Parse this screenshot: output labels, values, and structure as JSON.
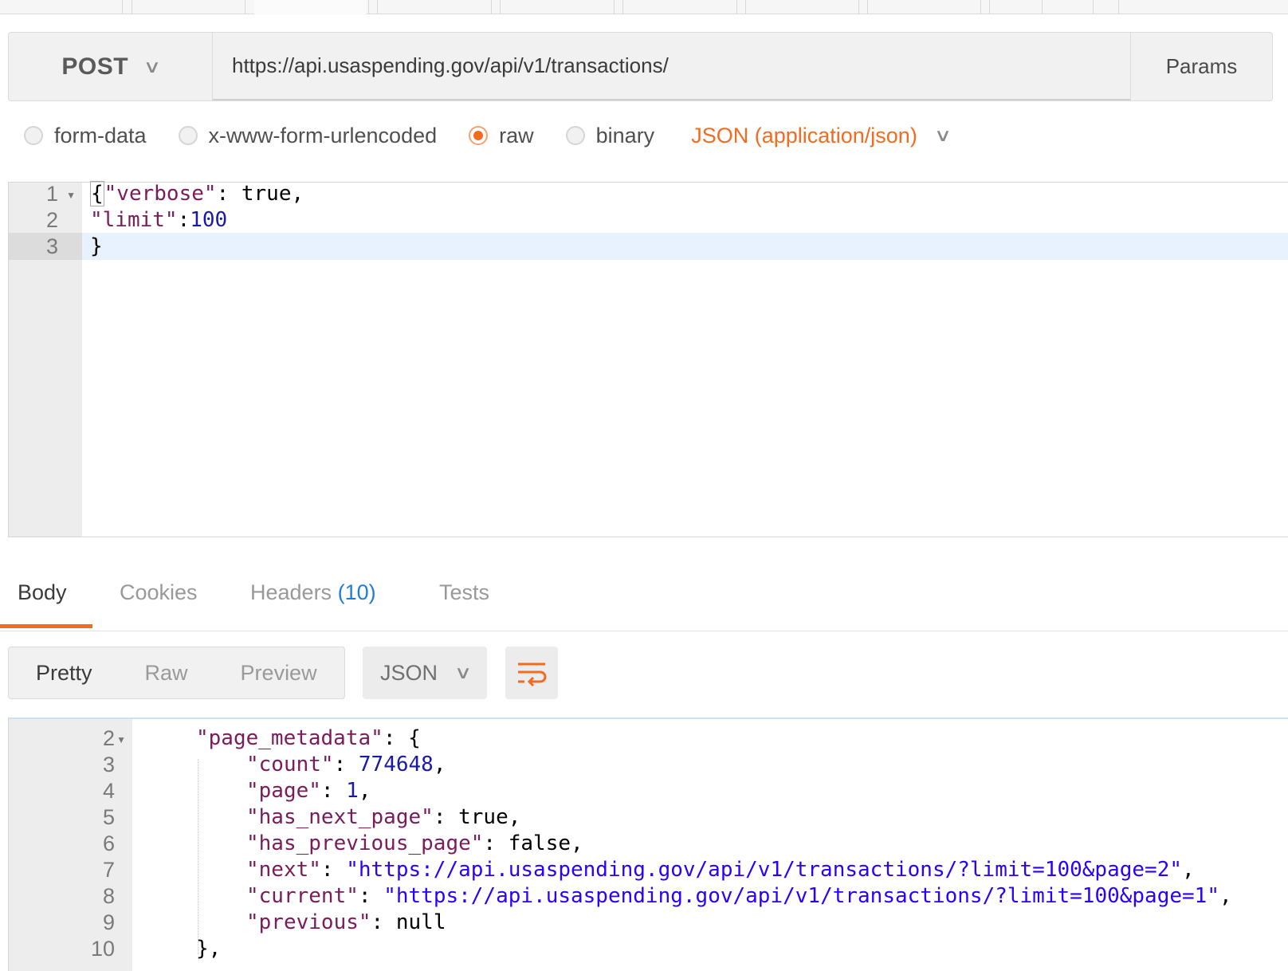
{
  "request": {
    "method": "POST",
    "url": "https://api.usaspending.gov/api/v1/transactions/",
    "params_label": "Params"
  },
  "body_types": [
    {
      "label": "form-data",
      "selected": false
    },
    {
      "label": "x-www-form-urlencoded",
      "selected": false
    },
    {
      "label": "raw",
      "selected": true
    },
    {
      "label": "binary",
      "selected": false
    }
  ],
  "content_type": "JSON (application/json)",
  "request_body": {
    "lines": [
      {
        "num": "1",
        "key": "\"verbose\"",
        "sep": ": ",
        "val": "true,"
      },
      {
        "num": "2",
        "key": "\"limit\"",
        "sep": ":",
        "val": "100"
      },
      {
        "num": "3",
        "text": "}"
      }
    ]
  },
  "response_tabs": {
    "body": "Body",
    "cookies": "Cookies",
    "headers": "Headers",
    "headers_count": "(10)",
    "tests": "Tests"
  },
  "view_modes": [
    "Pretty",
    "Raw",
    "Preview"
  ],
  "format": "JSON",
  "response_body": {
    "lines": [
      {
        "num": "2",
        "key": "\"page_metadata\"",
        "sep": ": ",
        "val": "{"
      },
      {
        "num": "3",
        "key": "\"count\"",
        "sep": ": ",
        "val": "774648",
        "tail": ","
      },
      {
        "num": "4",
        "key": "\"page\"",
        "sep": ": ",
        "val": "1",
        "tail": ","
      },
      {
        "num": "5",
        "key": "\"has_next_page\"",
        "sep": ": ",
        "val": "true,"
      },
      {
        "num": "6",
        "key": "\"has_previous_page\"",
        "sep": ": ",
        "val": "false,"
      },
      {
        "num": "7",
        "key": "\"next\"",
        "sep": ": ",
        "val": "\"https://api.usaspending.gov/api/v1/transactions/?limit=100&page=2\"",
        "tail": ","
      },
      {
        "num": "8",
        "key": "\"current\"",
        "sep": ": ",
        "val": "\"https://api.usaspending.gov/api/v1/transactions/?limit=100&page=1\"",
        "tail": ","
      },
      {
        "num": "9",
        "key": "\"previous\"",
        "sep": ": ",
        "val": "null"
      },
      {
        "num": "10",
        "text": "},"
      }
    ]
  },
  "colors": {
    "accent": "#f26b21",
    "json_key": "#7b1c5a",
    "json_number": "#1a1aa6",
    "json_string": "#2a00ff",
    "badge": "#1d7fd6"
  }
}
